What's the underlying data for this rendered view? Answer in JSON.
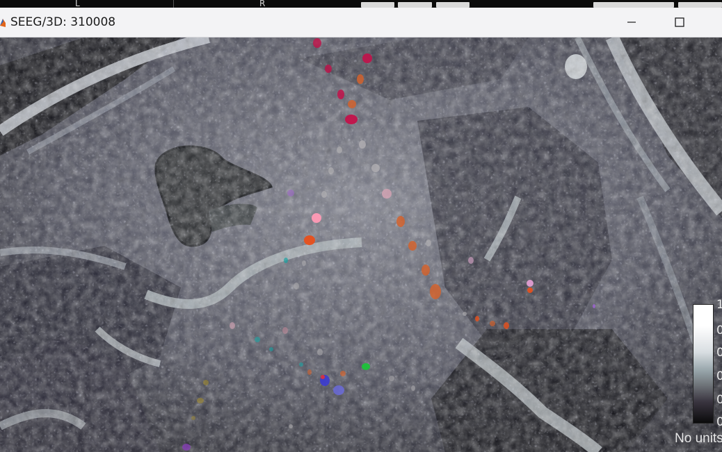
{
  "window": {
    "title": "SEEG/3D: 310008",
    "controls": {
      "minimize": "minimize",
      "maximize": "maximize"
    }
  },
  "top_strip": {
    "orientation_left": "L",
    "orientation_right": "R"
  },
  "colorbar": {
    "tick_labels": [
      "1",
      "0",
      "0",
      "0",
      "0",
      "0"
    ],
    "units_label": "No units"
  },
  "colors": {
    "titlebar_bg": "#f3f3f5",
    "contact_red": "#c2124a",
    "contact_orange": "#d2632e",
    "contact_grey": "#b8b5b8"
  },
  "icons": [
    "matlab-app-icon",
    "minimize-icon",
    "maximize-icon"
  ]
}
